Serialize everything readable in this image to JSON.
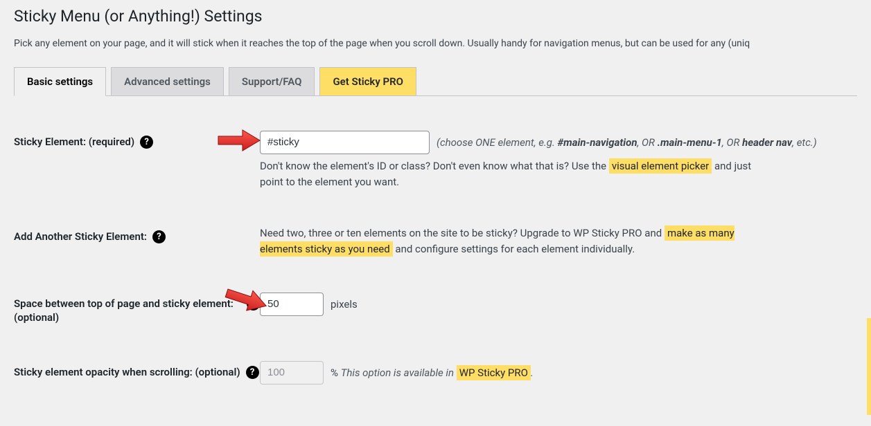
{
  "page": {
    "title": "Sticky Menu (or Anything!) Settings",
    "intro": "Pick any element on your page, and it will stick when it reaches the top of the page when you scroll down. Usually handy for navigation menus, but can be used for any (uniq"
  },
  "tabs": [
    {
      "label": "Basic settings",
      "active": true
    },
    {
      "label": "Advanced settings",
      "active": false
    },
    {
      "label": "Support/FAQ",
      "active": false
    },
    {
      "label": "Get Sticky PRO",
      "active": false,
      "pro": true
    }
  ],
  "fields": {
    "sticky_element": {
      "label": "Sticky Element: (required)",
      "value": "#sticky",
      "hint_pre": "(choose ONE element, e.g. ",
      "hint_s1": "#main-navigation",
      "hint_mid1": ", OR ",
      "hint_s2": ".main-menu-1",
      "hint_mid2": ", OR ",
      "hint_s3": "header nav",
      "hint_post": ", etc.)",
      "desc_a": "Don't know the element's ID or class? Don't even know what that is? Use the ",
      "desc_hl": "visual element picker",
      "desc_b": " and just point to the element you want."
    },
    "add_another": {
      "label": "Add Another Sticky Element:",
      "desc_a": "Need two, three or ten elements on the site to be sticky? Upgrade to WP Sticky PRO and ",
      "desc_hl": "make as many elements sticky as you need",
      "desc_b": " and configure settings for each element individually."
    },
    "space_top": {
      "label": "Space between top of page and sticky element: (optional)",
      "value": "50",
      "unit": "pixels"
    },
    "opacity": {
      "label": "Sticky element opacity when scrolling: (optional)",
      "value": "100",
      "unit_pre": "% ",
      "note_a": "This option is available in ",
      "note_hl": "WP Sticky PRO",
      "note_b": "."
    }
  },
  "icons": {
    "help": "?"
  }
}
